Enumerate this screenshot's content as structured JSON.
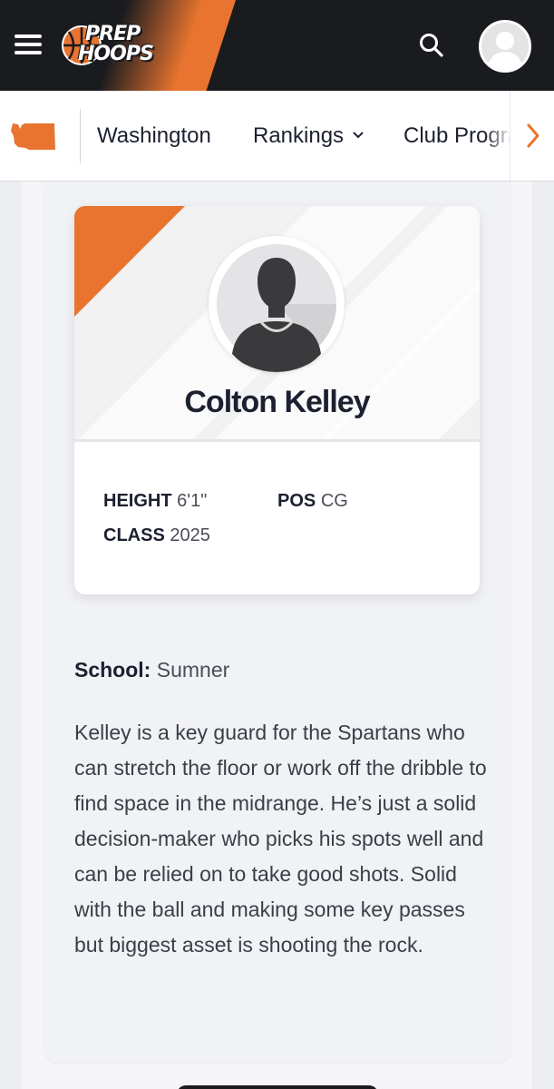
{
  "header": {
    "logo_line1": "PREP",
    "logo_line2": "HOOPS",
    "brand_color": "#e8742f",
    "menu_icon": "hamburger-icon",
    "search_icon": "search-icon",
    "account_icon": "user-avatar-icon"
  },
  "subnav": {
    "state_icon": "washington-state-icon",
    "items": [
      {
        "label": "Washington"
      },
      {
        "label": "Rankings",
        "icon": "chevron-down-icon"
      },
      {
        "label": "Club Programs"
      }
    ],
    "next_icon": "chevron-right-icon"
  },
  "player": {
    "name": "Colton Kelley",
    "avatar_icon": "player-silhouette-icon",
    "stats": {
      "height_label": "HEIGHT",
      "height_value": "6'1\"",
      "pos_label": "POS",
      "pos_value": "CG",
      "class_label": "CLASS",
      "class_value": "2025"
    },
    "school_label": "School:",
    "school_value": "Sumner",
    "bio": "Kelley is a key guard for the Spartans who can stretch the floor or work off the dribble to find space in the midrange. He’s just a solid decision-maker who picks his spots well and can be relied on to take good shots. Solid with the ball and making some key passes but biggest asset is shooting the rock."
  }
}
